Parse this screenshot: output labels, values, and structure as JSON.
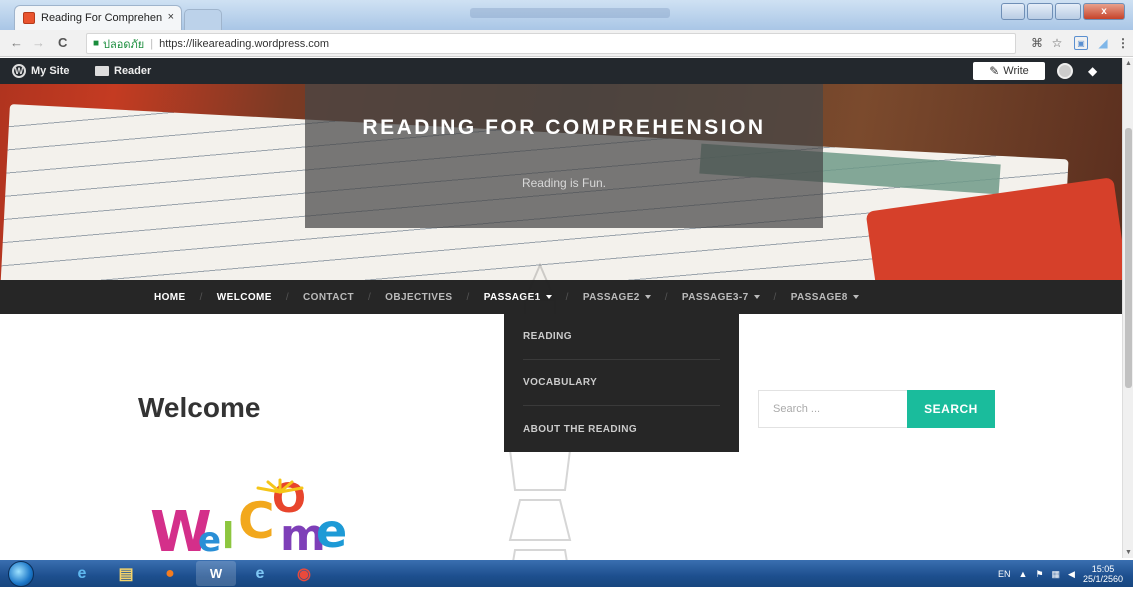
{
  "browser": {
    "tab_title": "Reading For Comprehen",
    "tab_close": "×",
    "secure_label": "ปลอดภัย",
    "url": "https://likeareading.wordpress.com",
    "back": "←",
    "forward": "→",
    "reload": "C"
  },
  "window_controls": {
    "minimize": "",
    "restore": "",
    "maximize": "",
    "close": "x"
  },
  "adminbar": {
    "my_site": "My Site",
    "reader": "Reader",
    "write": "Write"
  },
  "site": {
    "title": "READING FOR COMPREHENSION",
    "tagline": "Reading is Fun."
  },
  "nav": {
    "items": [
      {
        "label": "HOME"
      },
      {
        "label": "WELCOME"
      },
      {
        "label": "CONTACT"
      },
      {
        "label": "OBJECTIVES"
      },
      {
        "label": "PASSAGE1"
      },
      {
        "label": "PASSAGE2"
      },
      {
        "label": "PASSAGE3-7"
      },
      {
        "label": "PASSAGE8"
      }
    ],
    "separator": "/"
  },
  "dropdown": {
    "items": [
      {
        "label": "READING"
      },
      {
        "label": "VOCABULARY"
      },
      {
        "label": "ABOUT THE READING"
      }
    ]
  },
  "main": {
    "heading": "Welcome"
  },
  "search": {
    "placeholder": "Search ...",
    "button": "SEARCH"
  },
  "welcome_image": {
    "letters": [
      "W",
      "e",
      "l",
      "C",
      "O",
      "m",
      "e"
    ]
  },
  "taskbar": {
    "lang": "EN",
    "time": "15:05",
    "date": "25/1/2560"
  },
  "colors": {
    "accent": "#1abc9c",
    "nav_bg": "#262626",
    "adminbar_bg": "#23282d"
  }
}
